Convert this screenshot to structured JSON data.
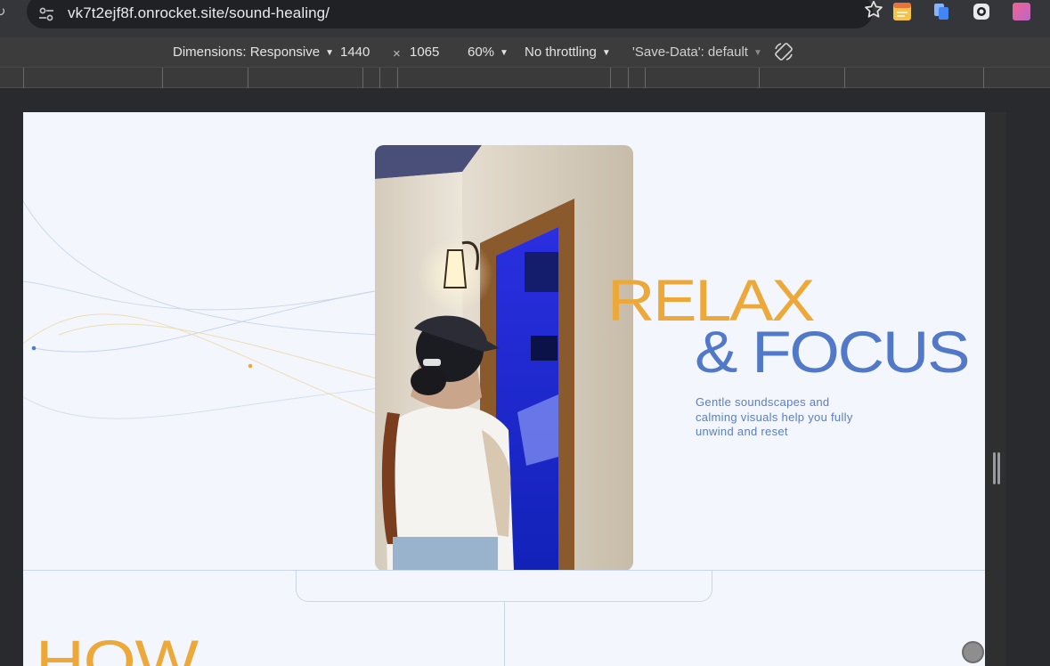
{
  "browser": {
    "url": "vk7t2ejf8f.onrocket.site/sound-healing/",
    "icons": [
      "site-info-icon",
      "bookmark-star-icon",
      "extension-notes-icon",
      "extension-copy-icon",
      "extension-camera-icon",
      "extension-gradient-icon"
    ]
  },
  "devtools": {
    "dimensions_label": "Dimensions: Responsive",
    "width_value": "1440",
    "times_symbol": "×",
    "height_value": "1065",
    "zoom": "60%",
    "throttling": "No throttling",
    "save_data": "'Save-Data': default",
    "caret": "▼"
  },
  "page": {
    "headline_line1": "RELAX",
    "headline_line2": "& FOCUS",
    "subtitle": "Gentle soundscapes and calming visuals help you fully unwind and reset",
    "next_heading": "HOW",
    "colors": {
      "accent_orange": "#eca93a",
      "accent_blue": "#5179c8",
      "page_background": "#f3f7fd"
    }
  }
}
